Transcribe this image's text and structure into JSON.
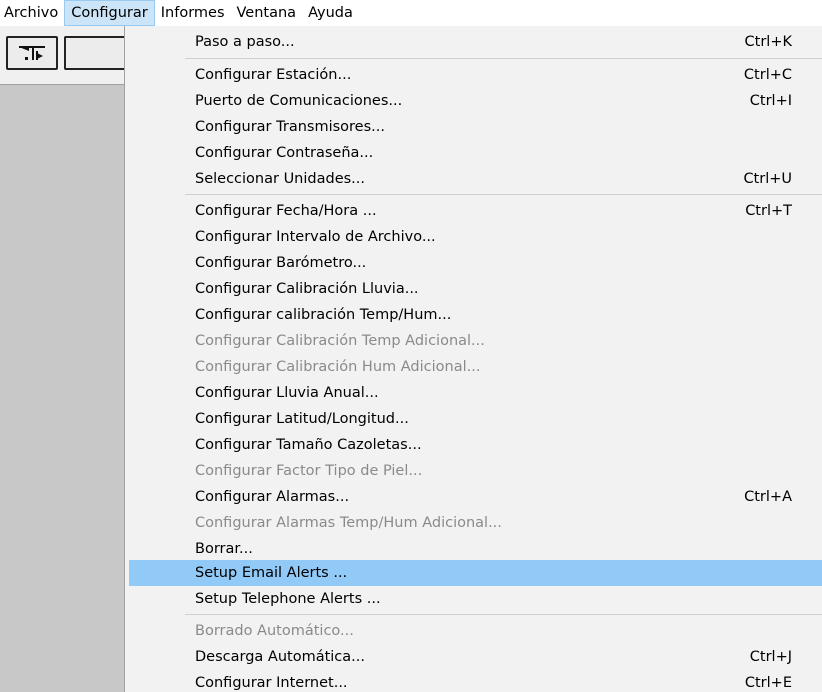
{
  "menubar": {
    "items": [
      {
        "label": "Archivo"
      },
      {
        "label": "Configurar"
      },
      {
        "label": "Informes"
      },
      {
        "label": "Ventana"
      },
      {
        "label": "Ayuda"
      }
    ],
    "active": "Configurar"
  },
  "toolbar": {
    "buttons": [
      {
        "icon": "wind-direction-icon"
      },
      {
        "icon": "toolbar-button-icon"
      }
    ]
  },
  "menu": {
    "items": [
      {
        "label": "Paso a paso...",
        "shortcut": "Ctrl+K",
        "enabled": true
      },
      {
        "label": "Configurar Estación...",
        "shortcut": "Ctrl+C",
        "enabled": true
      },
      {
        "label": "Puerto de Comunicaciones...",
        "shortcut": "Ctrl+I",
        "enabled": true
      },
      {
        "label": "Configurar Transmisores...",
        "shortcut": "",
        "enabled": true
      },
      {
        "label": "Configurar Contraseña...",
        "shortcut": "",
        "enabled": true
      },
      {
        "label": "Seleccionar Unidades...",
        "shortcut": "Ctrl+U",
        "enabled": true
      },
      {
        "label": "Configurar Fecha/Hora ...",
        "shortcut": "Ctrl+T",
        "enabled": true
      },
      {
        "label": "Configurar Intervalo de Archivo...",
        "shortcut": "",
        "enabled": true
      },
      {
        "label": "Configurar Barómetro...",
        "shortcut": "",
        "enabled": true
      },
      {
        "label": "Configurar Calibración Lluvia...",
        "shortcut": "",
        "enabled": true
      },
      {
        "label": "Configurar calibración Temp/Hum...",
        "shortcut": "",
        "enabled": true
      },
      {
        "label": "Configurar Calibración Temp Adicional...",
        "shortcut": "",
        "enabled": false
      },
      {
        "label": "Configurar Calibración Hum Adicional...",
        "shortcut": "",
        "enabled": false
      },
      {
        "label": "Configurar Lluvia Anual...",
        "shortcut": "",
        "enabled": true
      },
      {
        "label": "Configurar Latitud/Longitud...",
        "shortcut": "",
        "enabled": true
      },
      {
        "label": "Configurar Tamaño Cazoletas...",
        "shortcut": "",
        "enabled": true
      },
      {
        "label": "Configurar Factor Tipo de Piel...",
        "shortcut": "",
        "enabled": false
      },
      {
        "label": "Configurar Alarmas...",
        "shortcut": "Ctrl+A",
        "enabled": true
      },
      {
        "label": "Configurar Alarmas Temp/Hum Adicional...",
        "shortcut": "",
        "enabled": false
      },
      {
        "label": "Borrar...",
        "shortcut": "",
        "enabled": true
      },
      {
        "label": "Setup Email Alerts ...",
        "shortcut": "",
        "enabled": true,
        "highlighted": true
      },
      {
        "label": "Setup Telephone Alerts ...",
        "shortcut": "",
        "enabled": true
      },
      {
        "label": "Borrado Automático...",
        "shortcut": "",
        "enabled": false
      },
      {
        "label": "Descarga Automática...",
        "shortcut": "Ctrl+J",
        "enabled": true
      },
      {
        "label": "Configurar Internet...",
        "shortcut": "Ctrl+E",
        "enabled": true
      }
    ]
  },
  "colors": {
    "highlight": "#91c9f7",
    "menu_background": "#f2f2f2",
    "disabled_text": "#8a8a8a",
    "active_menubar": "#cce4f7"
  }
}
